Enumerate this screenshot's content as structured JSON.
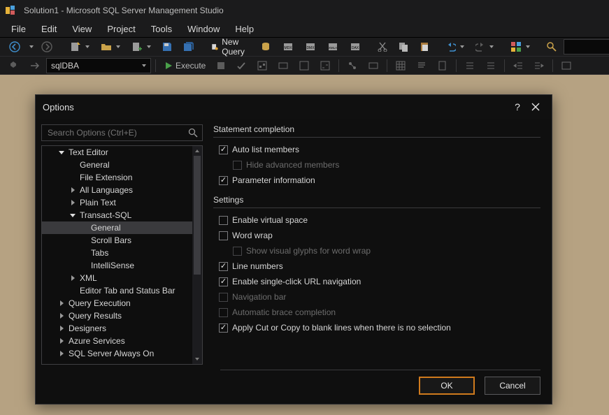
{
  "window": {
    "title": "Solution1 - Microsoft SQL Server Management Studio"
  },
  "menu": {
    "items": [
      "File",
      "Edit",
      "View",
      "Project",
      "Tools",
      "Window",
      "Help"
    ]
  },
  "toolbar": {
    "new_query": "New Query",
    "search_combo": ""
  },
  "toolbar2": {
    "db_combo": "sqlDBA",
    "execute": "Execute"
  },
  "dialog": {
    "title": "Options",
    "help": "?",
    "search_placeholder": "Search Options (Ctrl+E)",
    "tree": [
      {
        "lvl": 1,
        "exp": "open",
        "label": "Text Editor"
      },
      {
        "lvl": 2,
        "exp": "none",
        "label": "General"
      },
      {
        "lvl": 2,
        "exp": "none",
        "label": "File Extension"
      },
      {
        "lvl": 2,
        "exp": "closed",
        "label": "All Languages"
      },
      {
        "lvl": 2,
        "exp": "closed",
        "label": "Plain Text"
      },
      {
        "lvl": 2,
        "exp": "open",
        "label": "Transact-SQL",
        "id": "tsql"
      },
      {
        "lvl": 3,
        "exp": "none",
        "label": "General",
        "sel": true
      },
      {
        "lvl": 3,
        "exp": "none",
        "label": "Scroll Bars"
      },
      {
        "lvl": 3,
        "exp": "none",
        "label": "Tabs"
      },
      {
        "lvl": 3,
        "exp": "none",
        "label": "IntelliSense"
      },
      {
        "lvl": 2,
        "exp": "closed",
        "label": "XML"
      },
      {
        "lvl": 2,
        "exp": "none",
        "label": "Editor Tab and Status Bar"
      },
      {
        "lvl": 1,
        "exp": "closed",
        "label": "Query Execution"
      },
      {
        "lvl": 1,
        "exp": "closed",
        "label": "Query Results"
      },
      {
        "lvl": 1,
        "exp": "closed",
        "label": "Designers"
      },
      {
        "lvl": 1,
        "exp": "closed",
        "label": "Azure Services"
      },
      {
        "lvl": 1,
        "exp": "closed",
        "label": "SQL Server Always On"
      }
    ],
    "sections": {
      "statement": {
        "title": "Statement completion",
        "opts": [
          {
            "label": "Auto list members",
            "checked": true,
            "enabled": true
          },
          {
            "label": "Hide advanced members",
            "checked": false,
            "enabled": false,
            "indent": true
          },
          {
            "label": "Parameter information",
            "checked": true,
            "enabled": true
          }
        ]
      },
      "settings": {
        "title": "Settings",
        "opts": [
          {
            "label": "Enable virtual space",
            "checked": false,
            "enabled": true
          },
          {
            "label": "Word wrap",
            "checked": false,
            "enabled": true
          },
          {
            "label": "Show visual glyphs for word wrap",
            "checked": false,
            "enabled": false,
            "indent": true
          },
          {
            "label": "Line numbers",
            "checked": true,
            "enabled": true
          },
          {
            "label": "Enable single-click URL navigation",
            "checked": true,
            "enabled": true
          },
          {
            "label": "Navigation bar",
            "checked": false,
            "enabled": false
          },
          {
            "label": "Automatic brace completion",
            "checked": false,
            "enabled": false
          },
          {
            "label": "Apply Cut or Copy to blank lines when there is no selection",
            "checked": true,
            "enabled": true
          }
        ]
      }
    },
    "ok": "OK",
    "cancel": "Cancel"
  }
}
